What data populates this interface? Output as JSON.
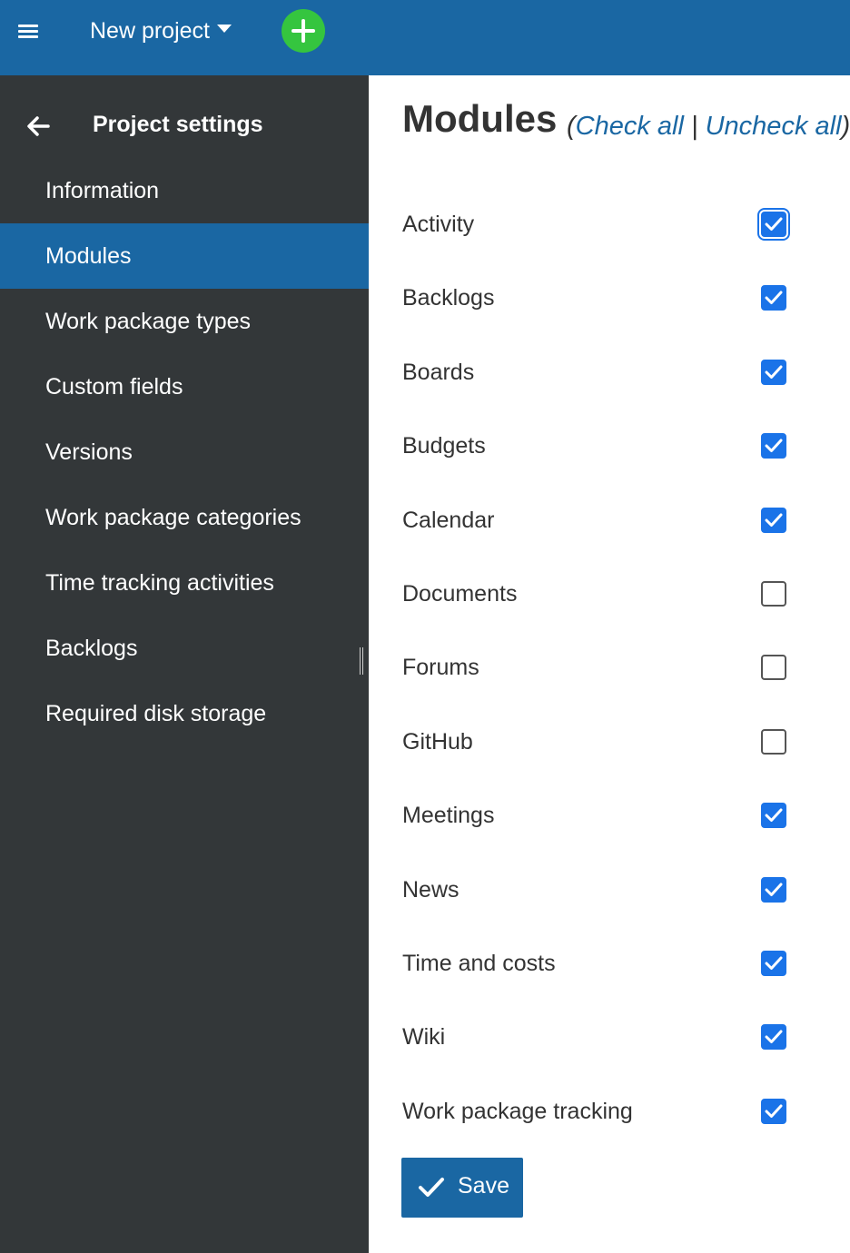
{
  "header": {
    "project_name": "New project",
    "icons": {
      "menu": "hamburger-menu-icon",
      "dropdown": "caret-down-icon",
      "add": "plus-circle-icon"
    },
    "colors": {
      "bar": "#1a67a3",
      "add_button": "#35c53f"
    }
  },
  "sidebar": {
    "title": "Project settings",
    "back_icon": "arrow-left-icon",
    "items": [
      {
        "label": "Information",
        "active": false
      },
      {
        "label": "Modules",
        "active": true
      },
      {
        "label": "Work package types",
        "active": false
      },
      {
        "label": "Custom fields",
        "active": false
      },
      {
        "label": "Versions",
        "active": false
      },
      {
        "label": "Work package categories",
        "active": false
      },
      {
        "label": "Time tracking activities",
        "active": false
      },
      {
        "label": "Backlogs",
        "active": false
      },
      {
        "label": "Required disk storage",
        "active": false
      }
    ],
    "colors": {
      "background": "#333739",
      "active": "#1a67a3"
    }
  },
  "main": {
    "title": "Modules",
    "check_all": "Check all",
    "uncheck_all": "Uncheck all",
    "modules": [
      {
        "label": "Activity",
        "checked": true
      },
      {
        "label": "Backlogs",
        "checked": true
      },
      {
        "label": "Boards",
        "checked": true
      },
      {
        "label": "Budgets",
        "checked": true
      },
      {
        "label": "Calendar",
        "checked": true
      },
      {
        "label": "Documents",
        "checked": false
      },
      {
        "label": "Forums",
        "checked": false
      },
      {
        "label": "GitHub",
        "checked": false
      },
      {
        "label": "Meetings",
        "checked": true
      },
      {
        "label": "News",
        "checked": true
      },
      {
        "label": "Time and costs",
        "checked": true
      },
      {
        "label": "Wiki",
        "checked": true
      },
      {
        "label": "Work package tracking",
        "checked": true
      }
    ],
    "save_label": "Save",
    "colors": {
      "checkbox_checked": "#1a73e8",
      "link": "#1a67a3"
    }
  }
}
